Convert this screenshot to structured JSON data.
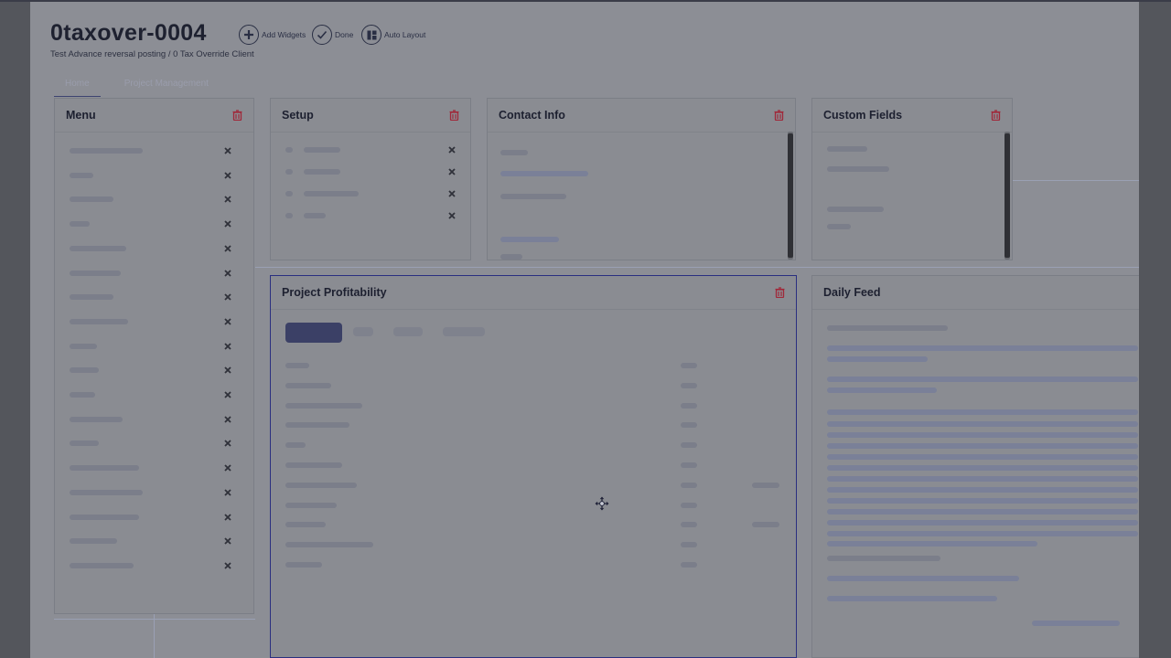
{
  "header": {
    "title": "0taxover-0004",
    "subtitle": "Test Advance reversal posting / 0 Tax Override Client"
  },
  "toolbar": {
    "add_widgets_label": "Add Widgets",
    "done_label": "Done",
    "auto_layout_label": "Auto Layout"
  },
  "tabs": [
    {
      "label": "Home",
      "active": true
    },
    {
      "label": "Project Management",
      "active": false
    }
  ],
  "widgets": {
    "menu": {
      "title": "Menu",
      "item_count": 18
    },
    "setup": {
      "title": "Setup",
      "item_count": 4
    },
    "contact_info": {
      "title": "Contact Info"
    },
    "custom_fields": {
      "title": "Custom Fields"
    },
    "project_profitability": {
      "title": "Project Profitability",
      "row_count": 11
    },
    "daily_feed": {
      "title": "Daily Feed"
    }
  },
  "colors": {
    "overlay": "#8c8e95",
    "accent": "#2a2f80",
    "delete": "#a0283a",
    "title_text": "#1e2130"
  },
  "icons": {
    "add": "plus-circle-icon",
    "done": "check-circle-icon",
    "auto_layout": "grid-layout-icon",
    "delete": "trash-icon",
    "move": "move-arrows-icon"
  }
}
